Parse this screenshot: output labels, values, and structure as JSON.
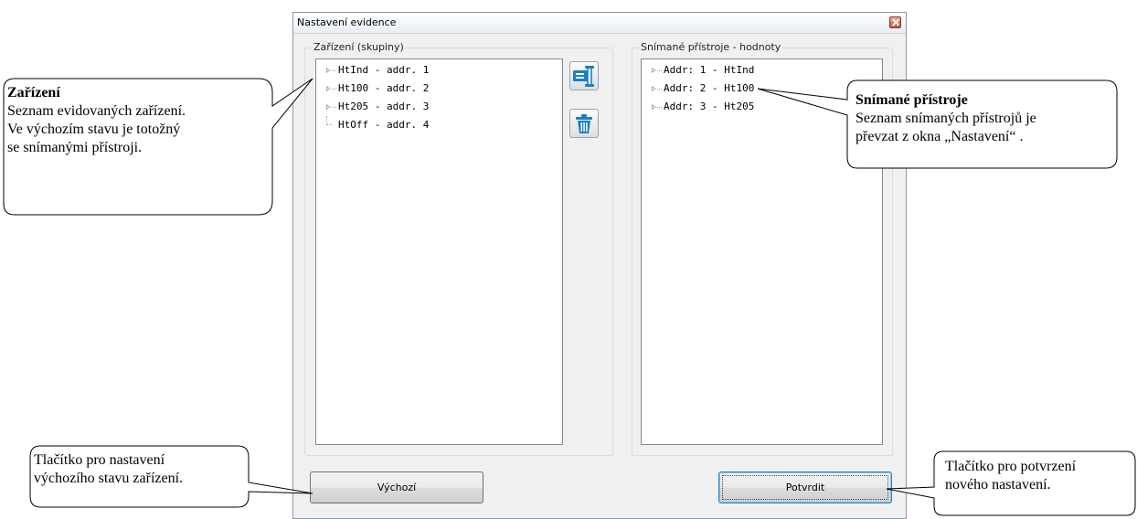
{
  "window": {
    "title": "Nastavení evidence",
    "close_icon": "close-icon"
  },
  "left_group": {
    "label": "Zařízení (skupiny)",
    "items": [
      {
        "label": "HtInd - addr. 1",
        "expandable": true
      },
      {
        "label": "Ht100 - addr. 2",
        "expandable": true
      },
      {
        "label": "Ht205 - addr. 3",
        "expandable": true
      },
      {
        "label": "HtOff - addr. 4",
        "expandable": false
      }
    ]
  },
  "right_group": {
    "label": "Snímané přístroje - hodnoty",
    "items": [
      {
        "label": "Addr: 1 - HtInd",
        "expandable": true
      },
      {
        "label": "Addr: 2 - Ht100",
        "expandable": true
      },
      {
        "label": "Addr: 3 - Ht205",
        "expandable": true
      }
    ]
  },
  "side_buttons": {
    "edit_icon": "edit-icon",
    "delete_icon": "trash-icon"
  },
  "buttons": {
    "default_label": "Výchozí",
    "confirm_label": "Potvrdit"
  },
  "callouts": {
    "devices": {
      "title": "Zařízení",
      "lines": [
        "Seznam evidovaných zařízení.",
        "Ve výchozím stavu je totožný",
        "se snímanými přístroji."
      ]
    },
    "sensed": {
      "title": "Snímané přístroje",
      "lines": [
        "Seznam snímaných přístrojů je",
        "převzat z okna „Nastavení“ ."
      ]
    },
    "default_button": {
      "lines": [
        "Tlačítko pro nastavení",
        "výchozího stavu zařízení."
      ]
    },
    "confirm_button": {
      "lines": [
        "Tlačítko pro potvrzení",
        "nového nastavení."
      ]
    }
  },
  "colors": {
    "accent_blue": "#1a7fc1",
    "window_bg": "#f0f0f0"
  }
}
